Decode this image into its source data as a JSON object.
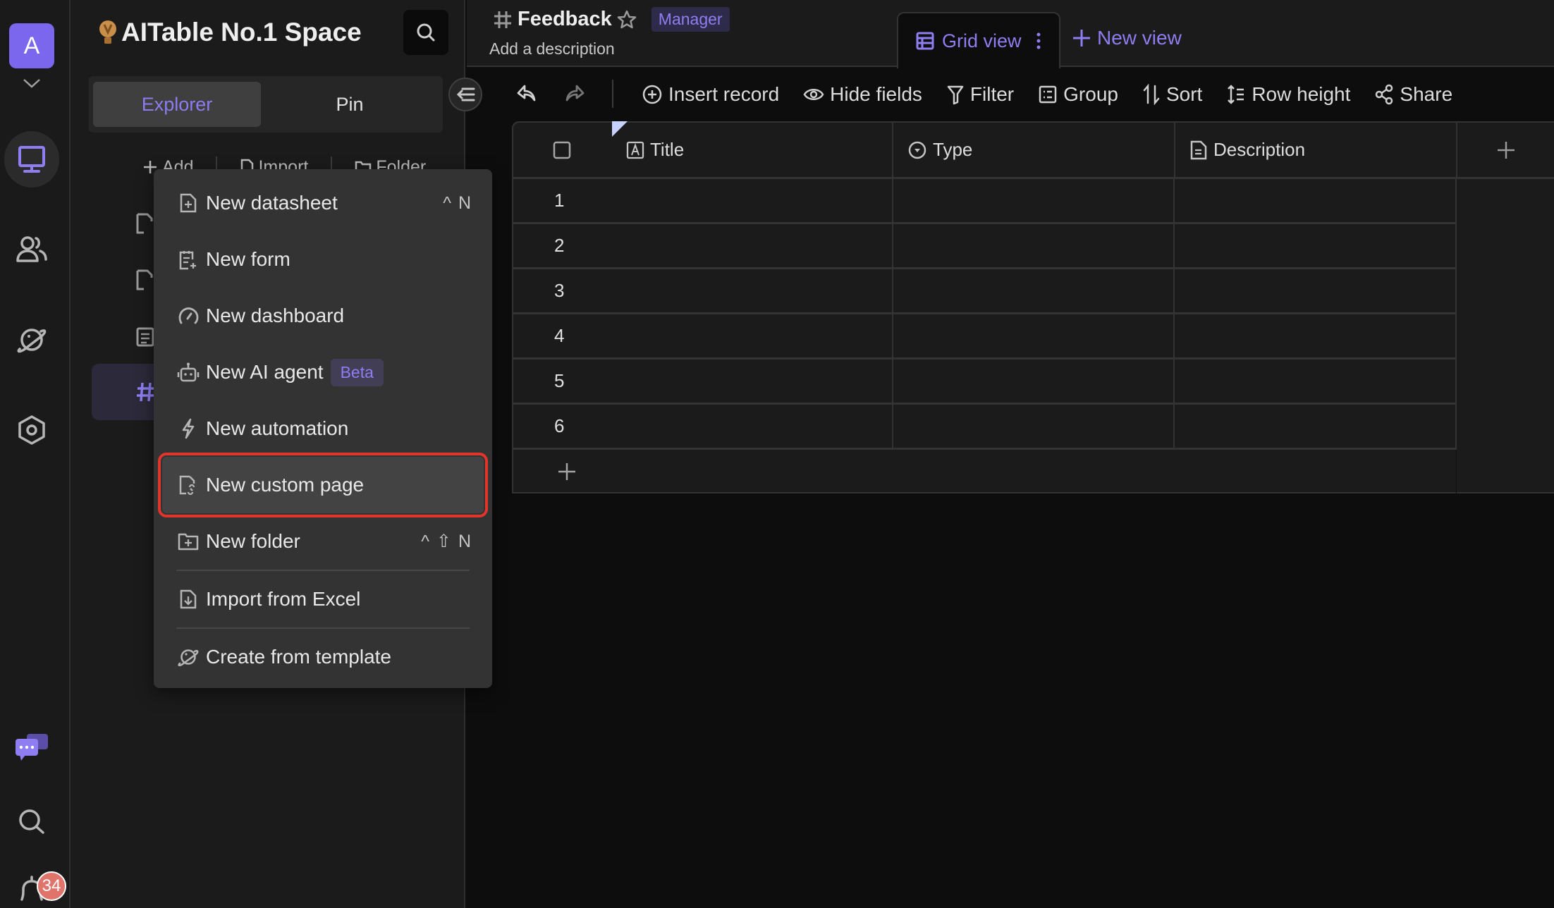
{
  "rail": {
    "avatar_letter": "A",
    "items": [
      {
        "name": "workspace",
        "icon": "monitor-icon",
        "active": true
      },
      {
        "name": "contacts",
        "icon": "users-icon",
        "active": false
      },
      {
        "name": "templates",
        "icon": "planet-icon",
        "active": false
      },
      {
        "name": "settings",
        "icon": "settings-icon",
        "active": false
      }
    ],
    "bottom": [
      {
        "name": "chat",
        "icon": "chat-icon"
      },
      {
        "name": "search",
        "icon": "search-icon"
      },
      {
        "name": "notifications",
        "icon": "bell-icon"
      }
    ],
    "notification_count": "34"
  },
  "sidebar": {
    "space_name": "AITable No.1 Space",
    "tabs": [
      {
        "label": "Explorer",
        "active": true
      },
      {
        "label": "Pin",
        "active": false
      }
    ],
    "actions": {
      "add": "Add",
      "import": "Import",
      "folder": "Folder"
    }
  },
  "header": {
    "title": "Feedback",
    "role_badge": "Manager",
    "description_placeholder": "Add a description",
    "active_view": "Grid view",
    "new_view": "New view"
  },
  "toolbar": {
    "insert_record": "Insert record",
    "hide_fields": "Hide fields",
    "filter": "Filter",
    "group": "Group",
    "sort": "Sort",
    "row_height": "Row height",
    "share": "Share"
  },
  "grid": {
    "columns": [
      {
        "name": "Title",
        "icon": "text-field-icon"
      },
      {
        "name": "Type",
        "icon": "single-select-icon"
      },
      {
        "name": "Description",
        "icon": "long-text-icon"
      }
    ],
    "rows": [
      "1",
      "2",
      "3",
      "4",
      "5",
      "6"
    ]
  },
  "menu": {
    "items": [
      {
        "label": "New datasheet",
        "icon": "new-datasheet-icon",
        "shortcut": [
          "^",
          "N"
        ]
      },
      {
        "label": "New form",
        "icon": "new-form-icon"
      },
      {
        "label": "New dashboard",
        "icon": "dashboard-icon"
      },
      {
        "label": "New AI agent",
        "icon": "robot-icon",
        "badge": "Beta"
      },
      {
        "label": "New automation",
        "icon": "lightning-icon"
      },
      {
        "label": "New custom page",
        "icon": "custom-page-icon",
        "highlighted": true
      },
      {
        "label": "New folder",
        "icon": "new-folder-icon",
        "shortcut": [
          "^",
          "⇧",
          "N"
        ]
      },
      {
        "label": "Import from Excel",
        "icon": "import-excel-icon"
      },
      {
        "label": "Create from template",
        "icon": "template-icon"
      }
    ],
    "highlight_color": "#e0352b"
  },
  "colors": {
    "accent": "#8e7ef1",
    "avatar": "#7b67ee",
    "badge": "#e0736a"
  }
}
